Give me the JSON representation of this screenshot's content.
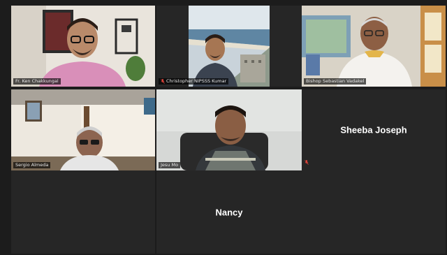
{
  "participants": [
    {
      "name": "Fr. Ken Chakkungal",
      "video": true,
      "speaking": true,
      "muted": false
    },
    {
      "name": "Christopher NIPSSS Kumar",
      "video": true,
      "speaking": false,
      "muted": true
    },
    {
      "name": "Bishop Sebastian Vadakel",
      "video": true,
      "speaking": false,
      "muted": false
    },
    {
      "name": "Sergio Almeda",
      "video": true,
      "speaking": false,
      "muted": false
    },
    {
      "name": "Jesu Mo",
      "video": true,
      "speaking": false,
      "muted": false
    },
    {
      "name": "Sheeba Joseph",
      "video": false,
      "speaking": false,
      "muted": true
    },
    {
      "name": "",
      "video": false,
      "speaking": false,
      "muted": false
    },
    {
      "name": "Nancy",
      "video": false,
      "speaking": false,
      "muted": false
    },
    {
      "name": "",
      "video": false,
      "speaking": false,
      "muted": false
    }
  ],
  "colors": {
    "speaker_border": "#c8e04a",
    "background": "#1c1c1c",
    "tile": "#262626",
    "muted_icon": "#e0443a"
  }
}
